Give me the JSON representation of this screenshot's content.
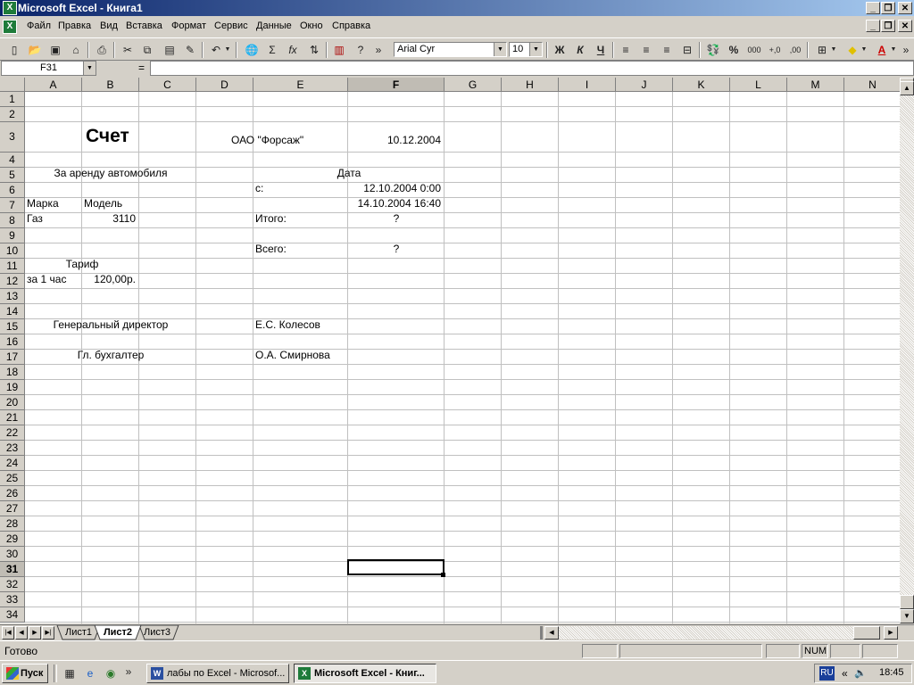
{
  "window": {
    "title": "Microsoft Excel - Книга1",
    "app_icon": "excel-icon"
  },
  "menu": [
    "Файл",
    "Правка",
    "Вид",
    "Вставка",
    "Формат",
    "Сервис",
    "Данные",
    "Окно",
    "Справка"
  ],
  "toolbar": {
    "font_name": "Arial Cyr",
    "font_size": "10",
    "bold": "Ж",
    "italic": "К",
    "underline": "Ч",
    "percent": "%",
    "thousands": "000",
    "inc_dec": ",0",
    "sigma": "Σ",
    "fx": "fx",
    "more": "»"
  },
  "formula_bar": {
    "name_box": "F31",
    "equals": "=",
    "value": ""
  },
  "columns": [
    "A",
    "B",
    "C",
    "D",
    "E",
    "F",
    "G",
    "H",
    "I",
    "J",
    "K",
    "L",
    "M",
    "N"
  ],
  "rows": [
    "1",
    "2",
    "3",
    "4",
    "5",
    "6",
    "7",
    "8",
    "9",
    "10",
    "11",
    "12",
    "13",
    "14",
    "15",
    "16",
    "17",
    "18",
    "19",
    "20",
    "21",
    "22",
    "23",
    "24",
    "25",
    "26",
    "27",
    "28",
    "29",
    "30",
    "31",
    "32",
    "33",
    "34"
  ],
  "cells": {
    "title": "Счет",
    "company": "ОАО \"Форсаж\"",
    "date": "10.12.2004",
    "rental": "За аренду автомобиля",
    "date_label": "Дата",
    "from_label": "с:",
    "from_value": "12.10.2004 0:00",
    "to_value": "14.10.2004 16:40",
    "brand_label": "Марка",
    "model_label": "Модель",
    "brand": "Газ",
    "model": "3110",
    "subtotal_label": "Итого:",
    "subtotal_value": "?",
    "total_label": "Всего:",
    "total_value": "?",
    "tariff_label": "Тариф",
    "per_hour": "за 1 час",
    "rate": "120,00р.",
    "director_label": "Генеральный директор",
    "director_name": "Е.С. Колесов",
    "accountant_label": "Гл. бухгалтер",
    "accountant_name": "О.А. Смирнова"
  },
  "sheet_tabs": [
    "Лист1",
    "Лист2",
    "Лист3"
  ],
  "active_sheet": "Лист2",
  "status": {
    "text": "Готово",
    "num": "NUM"
  },
  "taskbar": {
    "start": "Пуск",
    "tasks": [
      {
        "label": "лабы по Excel - Microsof...",
        "icon": "word-icon"
      },
      {
        "label": "Microsoft Excel - Книг...",
        "icon": "excel-icon"
      }
    ],
    "lang": "RU",
    "time": "18:45",
    "quicklaunch_more": "»",
    "tray_more": "«"
  }
}
